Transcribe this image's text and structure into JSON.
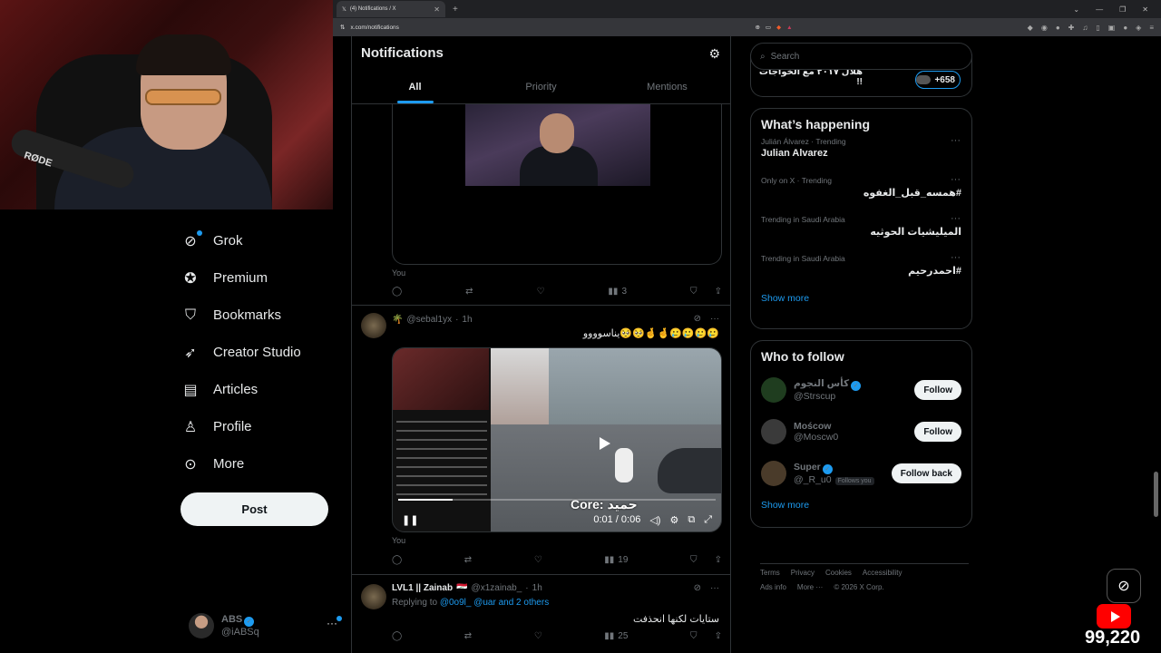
{
  "browser": {
    "tab_title": "(4) Notifications / X",
    "url": "x.com/notifications"
  },
  "webcam": {
    "mic_brand": "RØDE"
  },
  "nav": {
    "items": [
      {
        "label": "Grok",
        "icon": "grok-icon",
        "badge": true
      },
      {
        "label": "Premium",
        "icon": "premium-badge-icon",
        "badge": false
      },
      {
        "label": "Bookmarks",
        "icon": "bookmark-icon",
        "badge": false
      },
      {
        "label": "Creator Studio",
        "icon": "rocket-icon",
        "badge": false
      },
      {
        "label": "Articles",
        "icon": "article-icon",
        "badge": false
      },
      {
        "label": "Profile",
        "icon": "person-icon",
        "badge": false
      },
      {
        "label": "More",
        "icon": "more-circle-icon",
        "badge": false
      }
    ],
    "post_label": "Post"
  },
  "account": {
    "name": "ABS",
    "handle": "@iABSq"
  },
  "notifications": {
    "title": "Notifications",
    "tabs": [
      "All",
      "Priority",
      "Mentions"
    ],
    "active_tab": "All",
    "posts": [
      {
        "you": "You",
        "actions": {
          "views": "3"
        }
      },
      {
        "handle": "@sebal1yx",
        "time": "1h",
        "text": "يناسوووو🥺🥺🤞🤞🥲🥲🥲🥲",
        "video": {
          "caption": "Core: حميد",
          "time": "0:01 / 0:06",
          "progress": 0.17
        },
        "you": "You",
        "actions": {
          "views": "19"
        }
      },
      {
        "name": "LVL1 || Zainab",
        "handle": "@x1zainab_",
        "time": "1h",
        "reply_prefix": "Replying to",
        "reply_targets": "@0o9l_ @uar and 2 others",
        "text": "ستايات لكنها انحذفت",
        "actions": {
          "views": "25"
        }
      }
    ]
  },
  "sidebar": {
    "search_placeholder": "Search",
    "top_card": {
      "text": "هلال ٢٠١٧ مع الخواجات !!",
      "count": "+658"
    },
    "whats_happening": {
      "title": "What’s happening",
      "trends": [
        {
          "context": "Julián Álvarez · Trending",
          "title": "Julian Alvarez",
          "rtl": false
        },
        {
          "context": "Only on X · Trending",
          "title": "#همسه_قبل_الغفوه",
          "rtl": true
        },
        {
          "context": "Trending in Saudi Arabia",
          "title": "الميليشيات الحوثيه",
          "rtl": true
        },
        {
          "context": "Trending in Saudi Arabia",
          "title": "#احمدرحيم",
          "rtl": true
        }
      ],
      "show_more": "Show more"
    },
    "who_to_follow": {
      "title": "Who to follow",
      "accounts": [
        {
          "name": "كأس النجوم",
          "handle": "@Strscup",
          "verified": true,
          "follows_you": false,
          "button": "Follow",
          "avatar_color": "#1f3d1f"
        },
        {
          "name": "Moścow",
          "handle": "@Moscw0",
          "verified": false,
          "follows_you": false,
          "button": "Follow",
          "avatar_color": "#3a3a3a"
        },
        {
          "name": "Super",
          "handle": "@_R_u0",
          "verified": true,
          "follows_you": true,
          "button": "Follow back",
          "avatar_color": "#4a3b2a"
        }
      ],
      "follows_you_label": "Follows you",
      "show_more": "Show more"
    },
    "footer": {
      "links": [
        "Terms",
        "Privacy",
        "Cookies",
        "Accessibility",
        "Ads info",
        "More ···"
      ],
      "copyright": "© 2026 X Corp."
    }
  },
  "stream": {
    "viewers": "99,220"
  },
  "colors": {
    "accent": "#1d9bf0",
    "bg": "#000000",
    "muted": "#71767b",
    "border": "#2f3336"
  }
}
